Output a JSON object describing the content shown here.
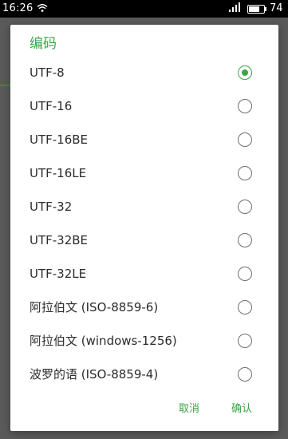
{
  "status_bar": {
    "time": "16:26",
    "wifi_icon": "wifi-icon",
    "signal_text": " ıll",
    "battery_level": 0.74,
    "battery_text": "74"
  },
  "dialog": {
    "title": "编码",
    "options": [
      {
        "label": "UTF-8",
        "selected": true
      },
      {
        "label": "UTF-16",
        "selected": false
      },
      {
        "label": "UTF-16BE",
        "selected": false
      },
      {
        "label": "UTF-16LE",
        "selected": false
      },
      {
        "label": "UTF-32",
        "selected": false
      },
      {
        "label": "UTF-32BE",
        "selected": false
      },
      {
        "label": "UTF-32LE",
        "selected": false
      },
      {
        "label": "阿拉伯文 (ISO-8859-6)",
        "selected": false
      },
      {
        "label": "阿拉伯文 (windows-1256)",
        "selected": false
      },
      {
        "label": "波罗的语 (ISO-8859-4)",
        "selected": false
      }
    ],
    "cancel_label": "取消",
    "ok_label": "确认"
  },
  "colors": {
    "accent": "#3aa647",
    "text": "#2b2b2b",
    "radio_border": "#6f6f6f",
    "status_bar": "#000000",
    "dim_background": "#4a4a4a"
  }
}
